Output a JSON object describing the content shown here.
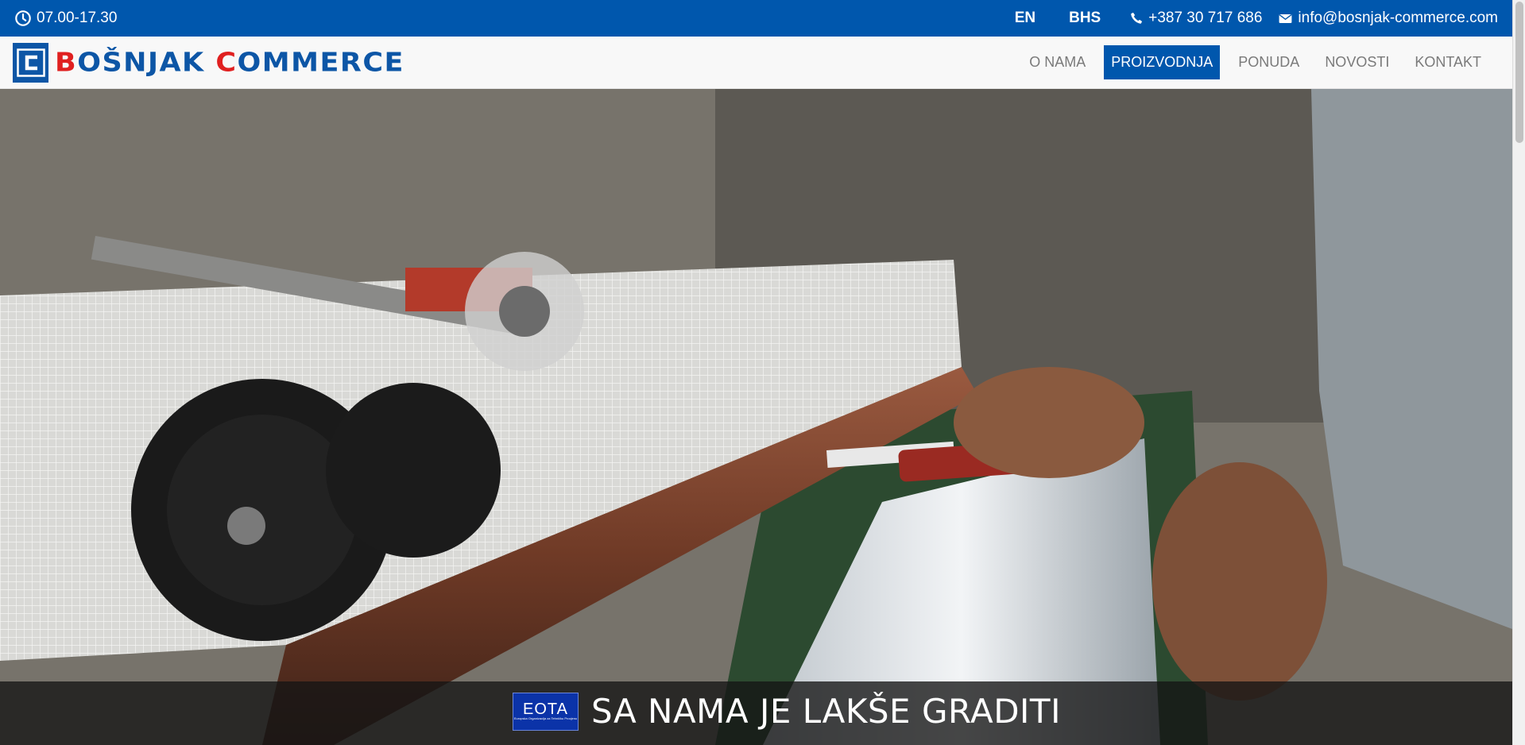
{
  "topbar": {
    "hours": "07.00-17.30",
    "languages": [
      "EN",
      "BHS"
    ],
    "phone": "+387 30 717 686",
    "email": "info@bosnjak-commerce.com"
  },
  "brand": {
    "letter": "C",
    "name_part1": "BOŠNJAK",
    "name_c": "C",
    "name_part2": "OMMERCE"
  },
  "menu": [
    {
      "label": "O NAMA",
      "active": false
    },
    {
      "label": "PROIZVODNJA",
      "active": true
    },
    {
      "label": "PONUDA",
      "active": false
    },
    {
      "label": "NOVOSTI",
      "active": false
    },
    {
      "label": "KONTAKT",
      "active": false
    }
  ],
  "hero": {
    "badge_title": "EOTA",
    "badge_subtitle": "Europska Organizacija za Tehničku Procjenu",
    "caption": "SA NAMA JE LAKŠE GRADITI"
  },
  "colors": {
    "primary": "#0057ad",
    "logo_red": "#e02020",
    "menu_text": "#7a7a7a"
  },
  "icons": [
    "clock-icon",
    "phone-icon",
    "envelope-icon"
  ]
}
